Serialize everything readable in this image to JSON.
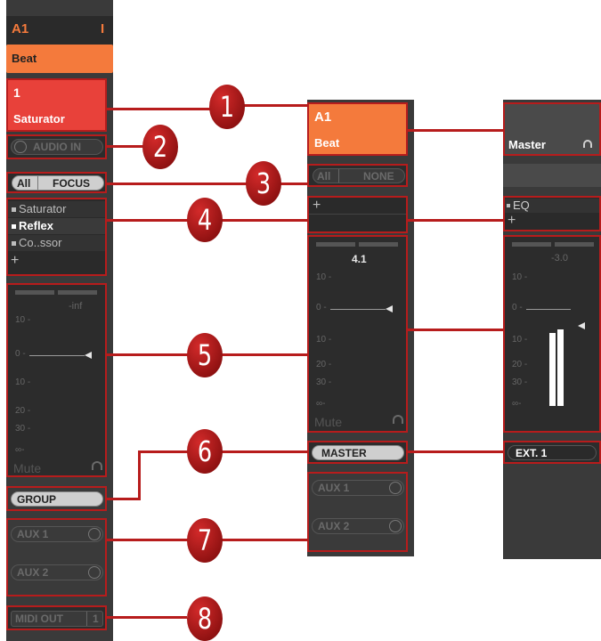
{
  "left_strip": {
    "header_label": "A1",
    "header_marker": "I",
    "group_name": "Beat",
    "sound_number": "1",
    "sound_name": "Saturator",
    "audio_in_label": "AUDIO IN",
    "focus_all": "All",
    "focus_mode": "FOCUS",
    "plugins": [
      "Saturator",
      "Reflex",
      "Co..ssor"
    ],
    "add_plus": "+",
    "level_readout": "-inf",
    "ticks": [
      "10 -",
      "0 -",
      "10 -",
      "20 -",
      "30 -",
      "∞-"
    ],
    "mute_label": "Mute",
    "output_label": "GROUP",
    "aux_sends": [
      "AUX 1",
      "AUX 2"
    ],
    "midi_out_label": "MIDI OUT",
    "midi_out_channel": "1"
  },
  "mid_strip": {
    "header_label": "A1",
    "group_name": "Beat",
    "focus_all": "All",
    "focus_mode": "NONE",
    "add_plus": "+",
    "level_readout": "4.1",
    "ticks": [
      "10 -",
      "0 -",
      "10 -",
      "20 -",
      "30 -",
      "∞-"
    ],
    "mute_label": "Mute",
    "output_label": "MASTER",
    "aux_sends": [
      "AUX 1",
      "AUX 2"
    ]
  },
  "right_strip": {
    "master_label": "Master",
    "plugins": [
      "EQ"
    ],
    "add_plus": "+",
    "level_readout": "-3.0",
    "ticks": [
      "10 -",
      "0 -",
      "10 -",
      "20 -",
      "30 -",
      "∞-"
    ],
    "output_label": "EXT. 1"
  },
  "callouts": [
    "1",
    "2",
    "3",
    "4",
    "5",
    "6",
    "7",
    "8"
  ],
  "colors": {
    "callout_red": "#b71c1c",
    "header_orange": "#f47a3c",
    "sound_red": "#e8413a",
    "strip_dark": "#2c2c2c"
  },
  "icons": [
    "headphones-icon",
    "knob-icon"
  ]
}
